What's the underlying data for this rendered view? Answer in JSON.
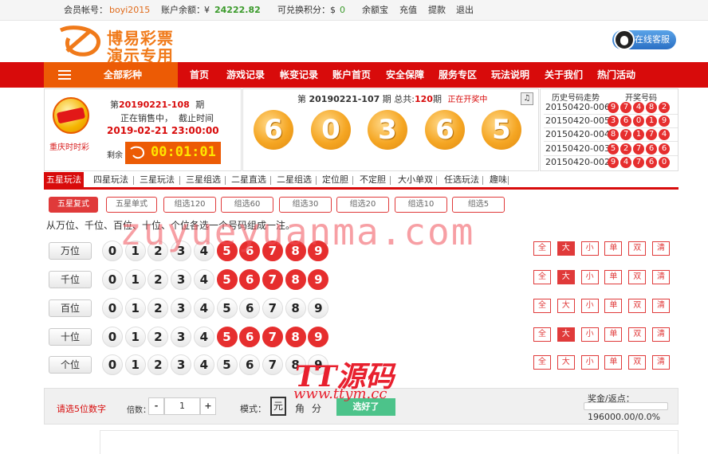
{
  "topbar": {
    "account_label": "会员帐号：",
    "account_value": "boyi2015",
    "balance_label": "账户余额：",
    "currency": "¥",
    "balance_value": "24222.82",
    "points_label": "可兑换积分：",
    "points_currency": "$",
    "points_value": "0",
    "links": [
      "余额宝",
      "充值",
      "提款",
      "退出"
    ]
  },
  "header": {
    "logo_line1": "博易彩票",
    "logo_line2": "演示专用",
    "service_label": "在线客服"
  },
  "nav": {
    "all_label": "全部彩种",
    "items": [
      "首页",
      "游戏记录",
      "帐变记录",
      "账户首页",
      "安全保障",
      "服务专区",
      "玩法说明",
      "关于我们",
      "热门活动"
    ]
  },
  "lottery": {
    "name": "重庆时时彩",
    "issue_prefix": "第",
    "issue": "20190221-108",
    "issue_suffix": "期",
    "status_line": "正在销售中，  截止时间",
    "deadline": "2019-02-21 23:00:00",
    "remain_label": "剩余",
    "countdown": "00:01:01"
  },
  "draw": {
    "prefix": "第",
    "issue": "20190221-107",
    "mid": "期 总共:",
    "total": "120",
    "suffix": "期",
    "status": "正在开奖中",
    "balls": [
      "6",
      "0",
      "3",
      "6",
      "5"
    ]
  },
  "history": {
    "title_trend": "历史号码走势",
    "title_nums": "开奖号码",
    "rows": [
      {
        "issue": "20150420-006",
        "nums": [
          "9",
          "7",
          "4",
          "8",
          "2"
        ]
      },
      {
        "issue": "20150420-005",
        "nums": [
          "3",
          "6",
          "0",
          "1",
          "9"
        ]
      },
      {
        "issue": "20150420-004",
        "nums": [
          "8",
          "7",
          "1",
          "7",
          "4"
        ]
      },
      {
        "issue": "20150420-003",
        "nums": [
          "5",
          "2",
          "7",
          "6",
          "6"
        ]
      },
      {
        "issue": "20150420-002",
        "nums": [
          "9",
          "4",
          "7",
          "6",
          "0"
        ]
      }
    ]
  },
  "tabs": [
    "五星玩法",
    "四星玩法",
    "三星玩法",
    "三星组选",
    "二星直选",
    "二星组选",
    "定位胆",
    "不定胆",
    "大小单双",
    "任选玩法",
    "趣味"
  ],
  "subtabs": [
    "五星复式",
    "五星单式",
    "组选120",
    "组选60",
    "组选30",
    "组选20",
    "组选10",
    "组选5"
  ],
  "hint": "从万位、千位、百位、十位、个位各选一个号码组成一注。",
  "rows": [
    {
      "label": "万位",
      "selected": [
        "5",
        "6",
        "7",
        "8",
        "9"
      ],
      "quick_active": "大"
    },
    {
      "label": "千位",
      "selected": [
        "5",
        "6",
        "7",
        "8",
        "9"
      ],
      "quick_active": "大"
    },
    {
      "label": "百位",
      "selected": [],
      "quick_active": ""
    },
    {
      "label": "十位",
      "selected": [
        "5",
        "6",
        "7",
        "8",
        "9"
      ],
      "quick_active": "大"
    },
    {
      "label": "个位",
      "selected": [],
      "quick_active": ""
    }
  ],
  "digits": [
    "0",
    "1",
    "2",
    "3",
    "4",
    "5",
    "6",
    "7",
    "8",
    "9"
  ],
  "quick": [
    "全",
    "大",
    "小",
    "单",
    "双",
    "清"
  ],
  "bottom": {
    "prompt": "请选5位数字",
    "multiple_label": "倍数：",
    "minus": "-",
    "multiple_value": "1",
    "plus": "+",
    "mode_label": "模式：",
    "modes": [
      "元",
      "角",
      "分"
    ],
    "confirm": "选好了",
    "prize_label": "奖金/返点：",
    "prize_value": "196000.00/0.0%",
    "slider_value": 0
  },
  "watermarks": {
    "url1": "zuyueyuanma.com",
    "logo": "TT源码",
    "url2": "www.ttym.cc"
  },
  "colors": {
    "brand_red": "#d80b0b",
    "brand_orange": "#ec5b05",
    "ball_red": "#e62e2e",
    "green": "#4cc38a"
  }
}
